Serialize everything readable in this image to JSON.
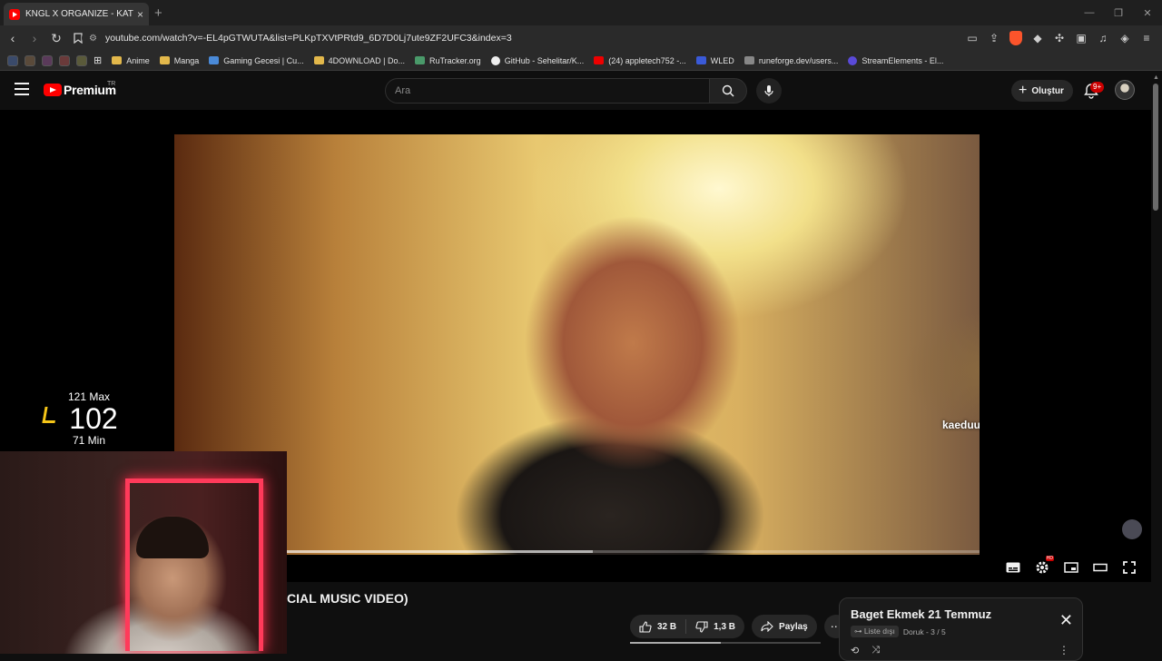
{
  "browser": {
    "tab_title": "KNGL X ORGANİZE - KATLİHAM",
    "tab_close": "×",
    "new_tab": "+",
    "url": "youtube.com/watch?v=-EL4pGTWUTA&list=PLKpTXVtPRtd9_6D7D0Lj7ute9ZF2UFC3&index=3",
    "bookmarks": [
      {
        "label": "Anime",
        "icon": "folder-icon"
      },
      {
        "label": "Manga",
        "icon": "folder-icon"
      },
      {
        "label": "Gaming Gecesi | Cu...",
        "icon": "bookmark-icon"
      },
      {
        "label": "4DOWNLOAD | Do...",
        "icon": "folder-icon"
      },
      {
        "label": "RuTracker.org",
        "icon": "bookmark-icon"
      },
      {
        "label": "GitHub - Sehelitar/K...",
        "icon": "github-icon"
      },
      {
        "label": "(24) appletech752 -...",
        "icon": "youtube-icon"
      },
      {
        "label": "WLED",
        "icon": "bookmark-icon"
      },
      {
        "label": "runeforge.dev/users...",
        "icon": "bookmark-icon"
      },
      {
        "label": "StreamElements - El...",
        "icon": "bookmark-icon"
      }
    ]
  },
  "youtube": {
    "logo_text": "Premium",
    "region": "TR",
    "search_placeholder": "Ara",
    "create_label": "Oluştur",
    "notif_count": "9+"
  },
  "overlay": {
    "max_label": "121 Max",
    "current": "102",
    "min_label": "71 Min",
    "chat_message": "kaeduu: dayın ne ki"
  },
  "player": {
    "progress": 0.52
  },
  "video": {
    "title_visible": "CIAL MUSIC VIDEO)",
    "likes": "32 B",
    "dislikes": "1,3 B",
    "share_label": "Paylaş",
    "more": "⋯"
  },
  "playlist": {
    "title": "Baget Ekmek 21 Temmuz",
    "privacy": "Liste dışı",
    "owner_position": "Doruk - 3 / 5",
    "close": "✕"
  },
  "colors": {
    "accent_red": "#ff0000",
    "overlay_yellow": "#f5c518",
    "neon": "#ff3a5a"
  }
}
